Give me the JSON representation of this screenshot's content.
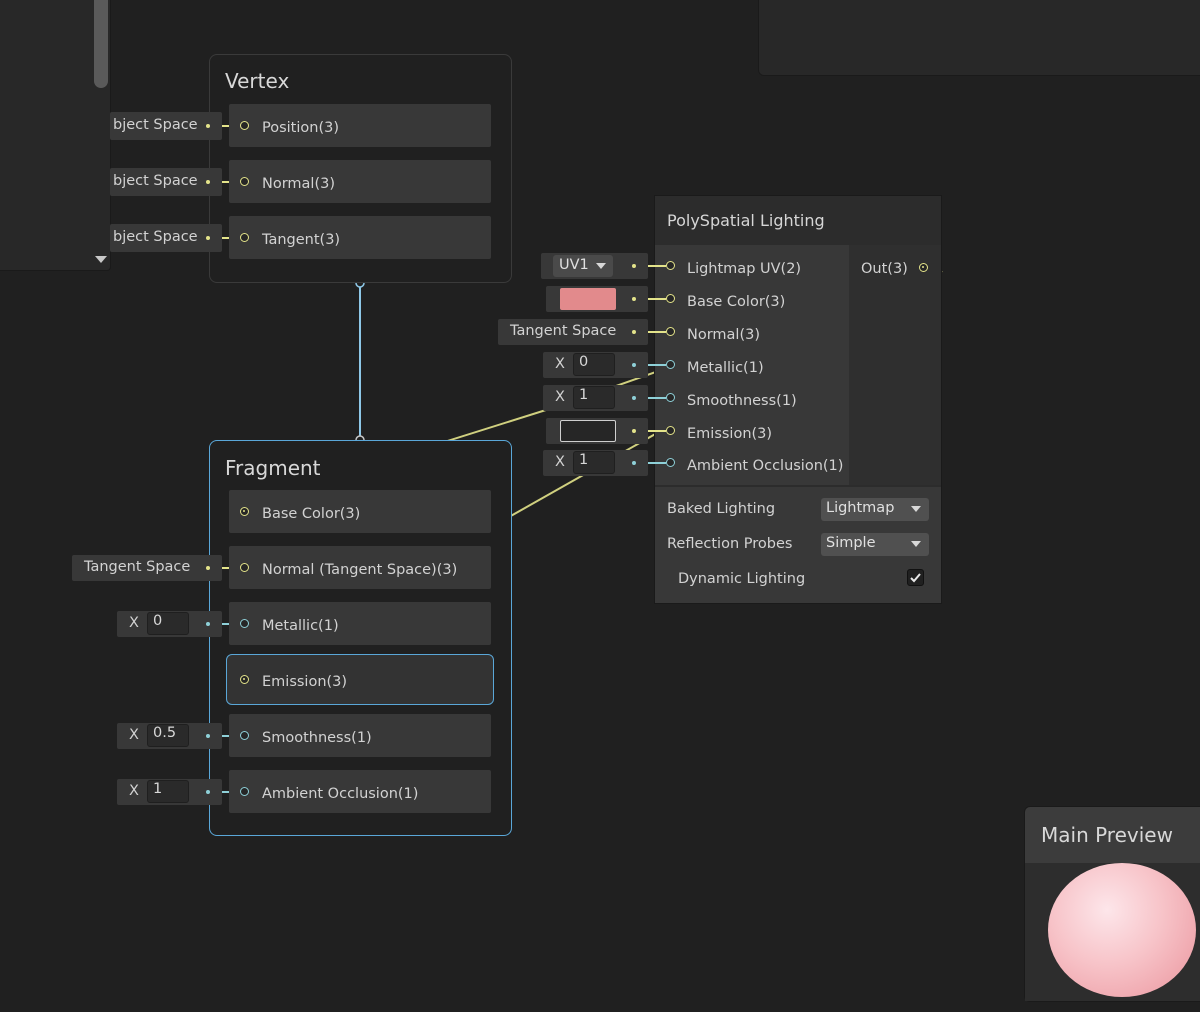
{
  "vertex": {
    "title": "Vertex",
    "inputs": [
      {
        "source": "bject Space",
        "label": "Position(3)"
      },
      {
        "source": "bject Space",
        "label": "Normal(3)"
      },
      {
        "source": "bject Space",
        "label": "Tangent(3)"
      }
    ]
  },
  "fragment": {
    "title": "Fragment",
    "blocks": [
      {
        "label": "Base Color(3)"
      },
      {
        "label": "Normal (Tangent Space)(3)",
        "source": "Tangent Space"
      },
      {
        "label": "Metallic(1)",
        "axis": "X",
        "value": "0"
      },
      {
        "label": "Emission(3)"
      },
      {
        "label": "Smoothness(1)",
        "axis": "X",
        "value": "0.5"
      },
      {
        "label": "Ambient Occlusion(1)",
        "axis": "X",
        "value": "1"
      }
    ]
  },
  "lighting_node": {
    "title": "PolySpatial Lighting",
    "inputs": [
      {
        "label": "Lightmap UV(2)",
        "control": "UV1"
      },
      {
        "label": "Base Color(3)",
        "color": "#e28a8c"
      },
      {
        "label": "Normal(3)",
        "control": "Tangent Space"
      },
      {
        "label": "Metallic(1)",
        "axis": "X",
        "value": "0"
      },
      {
        "label": "Smoothness(1)",
        "axis": "X",
        "value": "1"
      },
      {
        "label": "Emission(3)",
        "color": "#262626"
      },
      {
        "label": "Ambient Occlusion(1)",
        "axis": "X",
        "value": "1"
      }
    ],
    "output": "Out(3)",
    "settings": {
      "baked_lighting_label": "Baked Lighting",
      "baked_lighting_value": "Lightmap",
      "reflection_probes_label": "Reflection Probes",
      "reflection_probes_value": "Simple",
      "dynamic_lighting_label": "Dynamic Lighting",
      "dynamic_lighting_checked": true
    }
  },
  "preview": {
    "title": "Main Preview"
  },
  "colors": {
    "wire_yellow": "#e3e38a",
    "wire_blue": "#8ed0d8",
    "selection": "#5aa7d8"
  },
  "icons": [
    "caret-down-icon",
    "checkmark-icon",
    "scroll-arrow-down-icon"
  ]
}
